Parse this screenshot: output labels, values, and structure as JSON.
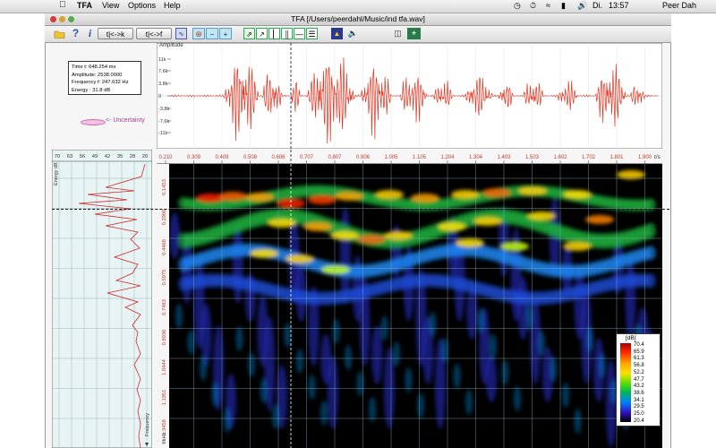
{
  "menubar": {
    "apple_icon": "apple-icon",
    "app_name": "TFA",
    "menus": [
      "View",
      "Options",
      "Help"
    ],
    "day": "Di.",
    "time": "13:57",
    "user": "Peer Dah"
  },
  "window": {
    "title": "TFA [/Users/peerdahl/Music/ind tfa.wav]"
  },
  "toolbar": {
    "btn_t_omega_k": "t|<->k",
    "btn_t_omega_f": "t|<->f"
  },
  "info_box": {
    "time_line": "Time t: 648.254 ms",
    "amplitude_line": "Amplitude: 2538.0000",
    "frequency_line": "Frequency f: 247.632 Hz",
    "energy_line": "Energy : 31.8 dB"
  },
  "uncertainty_label": "<- Uncertainty",
  "waveform": {
    "ylabel": "Amplitude",
    "y_ticks": [
      "11k",
      "7.6k",
      "3.8k",
      "0",
      "-3.8k",
      "-7.6k",
      "-11k"
    ]
  },
  "time_axis": {
    "unit": "t/s",
    "ticks": [
      "0.210",
      "0.309",
      "0.409",
      "0.508",
      "0.606",
      "0.707",
      "0.807",
      "0.906",
      "1.005",
      "1.105",
      "1.204",
      "1.304",
      "1.403",
      "1.503",
      "1.602",
      "1.702",
      "1.801",
      "1.900"
    ]
  },
  "energy_panel": {
    "xlabel": "Energy dB",
    "ylabel": "Frequency",
    "x_ticks": [
      "70",
      "63",
      "56",
      "49",
      "42",
      "35",
      "28",
      "20"
    ]
  },
  "spectrogram": {
    "freq_unit": "f/kHz",
    "freq_ticks": [
      "0.1453",
      "0.2906",
      "0.4468",
      "0.5975",
      "0.7483",
      "0.8936",
      "1.0444",
      "1.1951",
      "1.3458"
    ]
  },
  "colorbar": {
    "title": "[dB]",
    "levels": [
      "70.4",
      "65.9",
      "61.3",
      "56.8",
      "52.2",
      "47.7",
      "43.2",
      "38.6",
      "34.1",
      "29.5",
      "25.0",
      "20.4"
    ],
    "colors": [
      "#a00000",
      "#e00000",
      "#ff6000",
      "#ffa000",
      "#ffe000",
      "#c8ff00",
      "#40e000",
      "#00b830",
      "#0080ff",
      "#2040ff",
      "#3010c0",
      "#000000"
    ]
  },
  "colors": {
    "wave": "#e8321e",
    "grid": "#9ab6c0",
    "panel_bg": "#e8f4f4",
    "energy_line": "#cc2a2a",
    "tick_red": "#c0392b"
  }
}
